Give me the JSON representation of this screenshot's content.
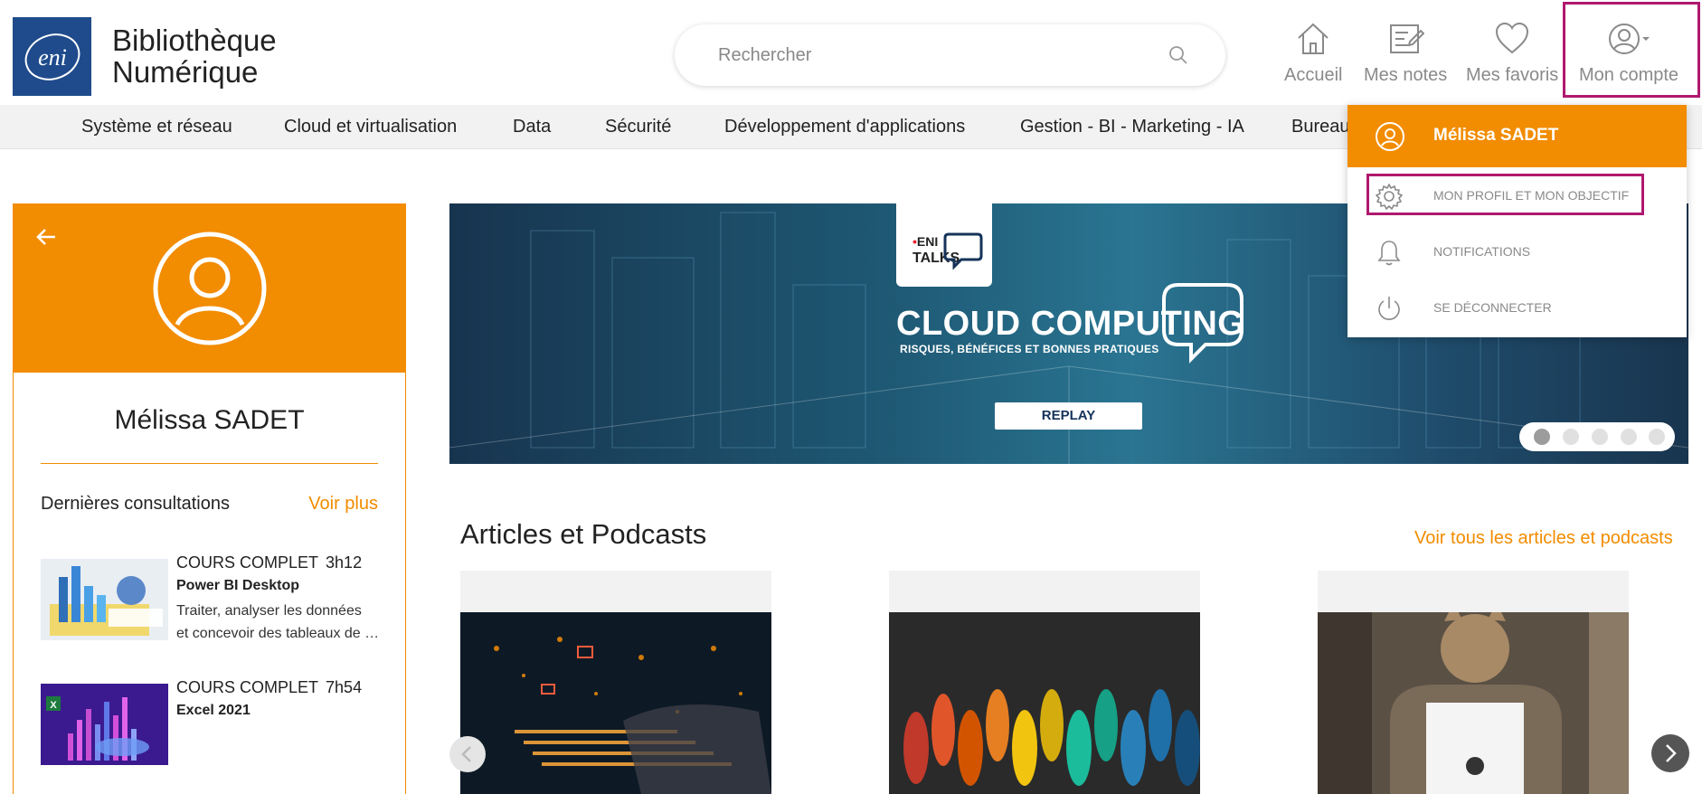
{
  "header": {
    "brand_line1": "Bibliothèque",
    "brand_line2": "Numérique",
    "logo_text": "eni",
    "search_placeholder": "Rechercher",
    "nav": {
      "accueil": "Accueil",
      "notes": "Mes notes",
      "favoris": "Mes favoris",
      "compte": "Mon compte"
    }
  },
  "categories": [
    "Système et réseau",
    "Cloud et virtualisation",
    "Data",
    "Sécurité",
    "Développement d'applications",
    "Gestion - BI - Marketing - IA",
    "Bureau"
  ],
  "profile_card": {
    "name": "Mélissa SADET",
    "recent_title": "Dernières consultations",
    "recent_more": "Voir plus",
    "courses": [
      {
        "kind": "COURS COMPLET",
        "duration": "3h12",
        "title": "Power BI Desktop",
        "desc_line1": "Traiter, analyser les données",
        "desc_line2": "et concevoir des tableaux de bord"
      },
      {
        "kind": "COURS COMPLET",
        "duration": "7h54",
        "title": "Excel 2021",
        "desc_line1": "",
        "desc_line2": ""
      }
    ]
  },
  "banner": {
    "badge_eni": "ENI",
    "badge_talks": "TALKS",
    "title": "CLOUD COMPUTING",
    "subtitle": "RISQUES, BÉNÉFICES ET BONNES PRATIQUES",
    "button": "REPLAY",
    "slide_count": 5,
    "active_slide": 1
  },
  "articles": {
    "title": "Articles et Podcasts",
    "more": "Voir tous les articles et podcasts"
  },
  "dropdown": {
    "user_name": "Mélissa SADET",
    "items": {
      "profile": "MON PROFIL ET MON OBJECTIF",
      "notifications": "NOTIFICATIONS",
      "logout": "SE DÉCONNECTER"
    }
  },
  "colors": {
    "accent": "#f28c00",
    "brand_blue": "#1f4b8c",
    "highlight": "#b0186e"
  }
}
